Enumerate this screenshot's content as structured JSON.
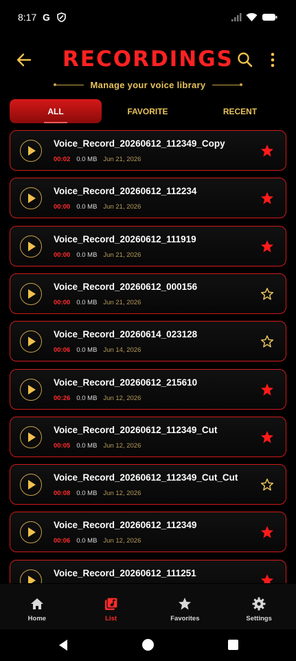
{
  "status_bar": {
    "time": "8:17",
    "icons": [
      "google-g-icon",
      "shield-icon",
      "signal-icon",
      "wifi-icon",
      "battery-icon"
    ]
  },
  "header": {
    "title": "RECORDINGS",
    "subtitle": "Manage your voice library",
    "icons": [
      "back-arrow-icon",
      "search-icon",
      "more-vert-icon"
    ]
  },
  "tabs": [
    {
      "label": "ALL",
      "active": true
    },
    {
      "label": "FAVORITE",
      "active": false
    },
    {
      "label": "RECENT",
      "active": false
    }
  ],
  "recordings": [
    {
      "name": "Voice_Record_20260612_112349_Copy",
      "duration": "00:02",
      "size": "0.0 MB",
      "date": "Jun 21, 2026",
      "favorite": true
    },
    {
      "name": "Voice_Record_20260612_112234",
      "duration": "00:00",
      "size": "0.0 MB",
      "date": "Jun 21, 2026",
      "favorite": true
    },
    {
      "name": "Voice_Record_20260612_111919",
      "duration": "00:00",
      "size": "0.0 MB",
      "date": "Jun 21, 2026",
      "favorite": true
    },
    {
      "name": "Voice_Record_20260612_000156",
      "duration": "00:00",
      "size": "0.0 MB",
      "date": "Jun 21, 2026",
      "favorite": false
    },
    {
      "name": "Voice_Record_20260614_023128",
      "duration": "00:06",
      "size": "0.0 MB",
      "date": "Jun 14, 2026",
      "favorite": false
    },
    {
      "name": "Voice_Record_20260612_215610",
      "duration": "00:26",
      "size": "0.0 MB",
      "date": "Jun 12, 2026",
      "favorite": true
    },
    {
      "name": "Voice_Record_20260612_112349_Cut",
      "duration": "00:05",
      "size": "0.0 MB",
      "date": "Jun 12, 2026",
      "favorite": true
    },
    {
      "name": "Voice_Record_20260612_112349_Cut_Cut",
      "duration": "00:08",
      "size": "0.0 MB",
      "date": "Jun 12, 2026",
      "favorite": false
    },
    {
      "name": "Voice_Record_20260612_112349",
      "duration": "00:06",
      "size": "0.0 MB",
      "date": "Jun 12, 2026",
      "favorite": true
    },
    {
      "name": "Voice_Record_20260612_111251",
      "duration": "",
      "size": "",
      "date": "",
      "favorite": true
    }
  ],
  "bottom_nav": [
    {
      "label": "Home",
      "icon": "home-icon",
      "active": false
    },
    {
      "label": "List",
      "icon": "music-list-icon",
      "active": true
    },
    {
      "label": "Favorites",
      "icon": "star-icon",
      "active": false
    },
    {
      "label": "Settings",
      "icon": "gear-icon",
      "active": false
    }
  ],
  "colors": {
    "accent_red": "#ff2222",
    "gold": "#e8c35c",
    "background": "#000000"
  }
}
